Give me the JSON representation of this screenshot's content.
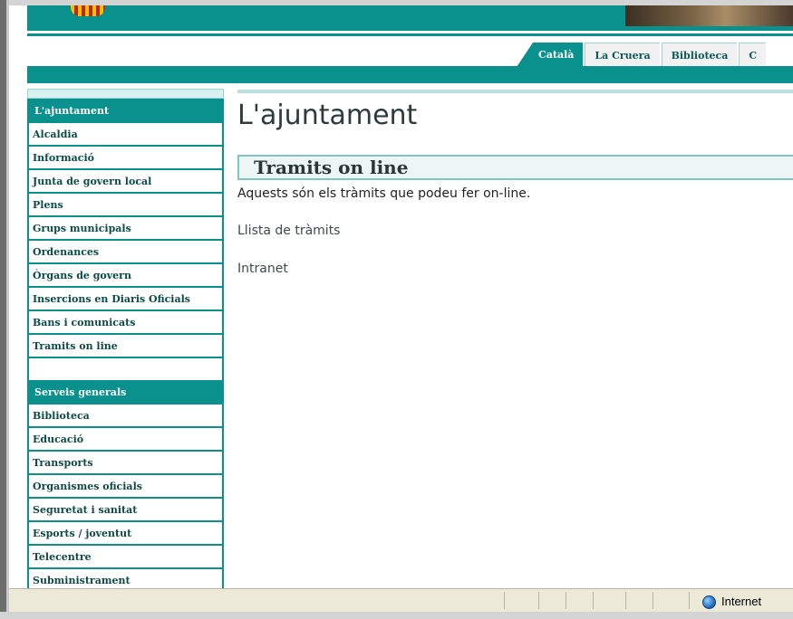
{
  "header": {
    "tabs": [
      {
        "label": "Català",
        "active": true
      },
      {
        "label": "La Cruera",
        "active": false
      },
      {
        "label": "Biblioteca",
        "active": false
      },
      {
        "label": "C",
        "active": false
      }
    ]
  },
  "sidebar": {
    "group1": {
      "header": "L'ajuntament",
      "items": [
        "Alcaldia",
        "Informació",
        "Junta de govern local",
        "Plens",
        "Grups municipals",
        "Ordenances",
        "Òrgans de govern",
        "Insercions en Diaris Oficials",
        "Bans i comunicats",
        "Tramits on line"
      ]
    },
    "group2": {
      "header": "Serveis generals",
      "items": [
        "Biblioteca",
        "Educació",
        "Transports",
        "Organismes oficials",
        "Seguretat i sanitat",
        "Esports / joventut",
        "Telecentre",
        "Subministrament"
      ]
    }
  },
  "main": {
    "title": "L'ajuntament",
    "section_title": "Tramits on line",
    "intro": "Aquests són els tràmits que podeu fer on-line.",
    "links": [
      "Llista de tràmits",
      "Intranet"
    ]
  },
  "statusbar": {
    "zone": "Internet"
  },
  "colors": {
    "accent": "#0b918d",
    "sidebar_text": "#0b4b48"
  }
}
